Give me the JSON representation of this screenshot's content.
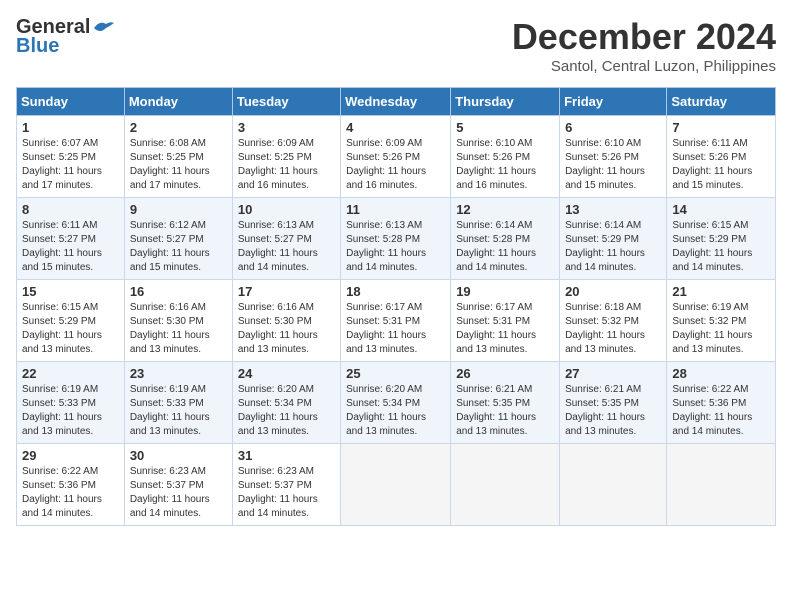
{
  "logo": {
    "line1": "General",
    "line2": "Blue"
  },
  "title": "December 2024",
  "subtitle": "Santol, Central Luzon, Philippines",
  "headers": [
    "Sunday",
    "Monday",
    "Tuesday",
    "Wednesday",
    "Thursday",
    "Friday",
    "Saturday"
  ],
  "weeks": [
    [
      {
        "day": "1",
        "sunrise": "Sunrise: 6:07 AM",
        "sunset": "Sunset: 5:25 PM",
        "daylight": "Daylight: 11 hours and 17 minutes."
      },
      {
        "day": "2",
        "sunrise": "Sunrise: 6:08 AM",
        "sunset": "Sunset: 5:25 PM",
        "daylight": "Daylight: 11 hours and 17 minutes."
      },
      {
        "day": "3",
        "sunrise": "Sunrise: 6:09 AM",
        "sunset": "Sunset: 5:25 PM",
        "daylight": "Daylight: 11 hours and 16 minutes."
      },
      {
        "day": "4",
        "sunrise": "Sunrise: 6:09 AM",
        "sunset": "Sunset: 5:26 PM",
        "daylight": "Daylight: 11 hours and 16 minutes."
      },
      {
        "day": "5",
        "sunrise": "Sunrise: 6:10 AM",
        "sunset": "Sunset: 5:26 PM",
        "daylight": "Daylight: 11 hours and 16 minutes."
      },
      {
        "day": "6",
        "sunrise": "Sunrise: 6:10 AM",
        "sunset": "Sunset: 5:26 PM",
        "daylight": "Daylight: 11 hours and 15 minutes."
      },
      {
        "day": "7",
        "sunrise": "Sunrise: 6:11 AM",
        "sunset": "Sunset: 5:26 PM",
        "daylight": "Daylight: 11 hours and 15 minutes."
      }
    ],
    [
      {
        "day": "8",
        "sunrise": "Sunrise: 6:11 AM",
        "sunset": "Sunset: 5:27 PM",
        "daylight": "Daylight: 11 hours and 15 minutes."
      },
      {
        "day": "9",
        "sunrise": "Sunrise: 6:12 AM",
        "sunset": "Sunset: 5:27 PM",
        "daylight": "Daylight: 11 hours and 15 minutes."
      },
      {
        "day": "10",
        "sunrise": "Sunrise: 6:13 AM",
        "sunset": "Sunset: 5:27 PM",
        "daylight": "Daylight: 11 hours and 14 minutes."
      },
      {
        "day": "11",
        "sunrise": "Sunrise: 6:13 AM",
        "sunset": "Sunset: 5:28 PM",
        "daylight": "Daylight: 11 hours and 14 minutes."
      },
      {
        "day": "12",
        "sunrise": "Sunrise: 6:14 AM",
        "sunset": "Sunset: 5:28 PM",
        "daylight": "Daylight: 11 hours and 14 minutes."
      },
      {
        "day": "13",
        "sunrise": "Sunrise: 6:14 AM",
        "sunset": "Sunset: 5:29 PM",
        "daylight": "Daylight: 11 hours and 14 minutes."
      },
      {
        "day": "14",
        "sunrise": "Sunrise: 6:15 AM",
        "sunset": "Sunset: 5:29 PM",
        "daylight": "Daylight: 11 hours and 14 minutes."
      }
    ],
    [
      {
        "day": "15",
        "sunrise": "Sunrise: 6:15 AM",
        "sunset": "Sunset: 5:29 PM",
        "daylight": "Daylight: 11 hours and 13 minutes."
      },
      {
        "day": "16",
        "sunrise": "Sunrise: 6:16 AM",
        "sunset": "Sunset: 5:30 PM",
        "daylight": "Daylight: 11 hours and 13 minutes."
      },
      {
        "day": "17",
        "sunrise": "Sunrise: 6:16 AM",
        "sunset": "Sunset: 5:30 PM",
        "daylight": "Daylight: 11 hours and 13 minutes."
      },
      {
        "day": "18",
        "sunrise": "Sunrise: 6:17 AM",
        "sunset": "Sunset: 5:31 PM",
        "daylight": "Daylight: 11 hours and 13 minutes."
      },
      {
        "day": "19",
        "sunrise": "Sunrise: 6:17 AM",
        "sunset": "Sunset: 5:31 PM",
        "daylight": "Daylight: 11 hours and 13 minutes."
      },
      {
        "day": "20",
        "sunrise": "Sunrise: 6:18 AM",
        "sunset": "Sunset: 5:32 PM",
        "daylight": "Daylight: 11 hours and 13 minutes."
      },
      {
        "day": "21",
        "sunrise": "Sunrise: 6:19 AM",
        "sunset": "Sunset: 5:32 PM",
        "daylight": "Daylight: 11 hours and 13 minutes."
      }
    ],
    [
      {
        "day": "22",
        "sunrise": "Sunrise: 6:19 AM",
        "sunset": "Sunset: 5:33 PM",
        "daylight": "Daylight: 11 hours and 13 minutes."
      },
      {
        "day": "23",
        "sunrise": "Sunrise: 6:19 AM",
        "sunset": "Sunset: 5:33 PM",
        "daylight": "Daylight: 11 hours and 13 minutes."
      },
      {
        "day": "24",
        "sunrise": "Sunrise: 6:20 AM",
        "sunset": "Sunset: 5:34 PM",
        "daylight": "Daylight: 11 hours and 13 minutes."
      },
      {
        "day": "25",
        "sunrise": "Sunrise: 6:20 AM",
        "sunset": "Sunset: 5:34 PM",
        "daylight": "Daylight: 11 hours and 13 minutes."
      },
      {
        "day": "26",
        "sunrise": "Sunrise: 6:21 AM",
        "sunset": "Sunset: 5:35 PM",
        "daylight": "Daylight: 11 hours and 13 minutes."
      },
      {
        "day": "27",
        "sunrise": "Sunrise: 6:21 AM",
        "sunset": "Sunset: 5:35 PM",
        "daylight": "Daylight: 11 hours and 13 minutes."
      },
      {
        "day": "28",
        "sunrise": "Sunrise: 6:22 AM",
        "sunset": "Sunset: 5:36 PM",
        "daylight": "Daylight: 11 hours and 14 minutes."
      }
    ],
    [
      {
        "day": "29",
        "sunrise": "Sunrise: 6:22 AM",
        "sunset": "Sunset: 5:36 PM",
        "daylight": "Daylight: 11 hours and 14 minutes."
      },
      {
        "day": "30",
        "sunrise": "Sunrise: 6:23 AM",
        "sunset": "Sunset: 5:37 PM",
        "daylight": "Daylight: 11 hours and 14 minutes."
      },
      {
        "day": "31",
        "sunrise": "Sunrise: 6:23 AM",
        "sunset": "Sunset: 5:37 PM",
        "daylight": "Daylight: 11 hours and 14 minutes."
      },
      null,
      null,
      null,
      null
    ]
  ]
}
